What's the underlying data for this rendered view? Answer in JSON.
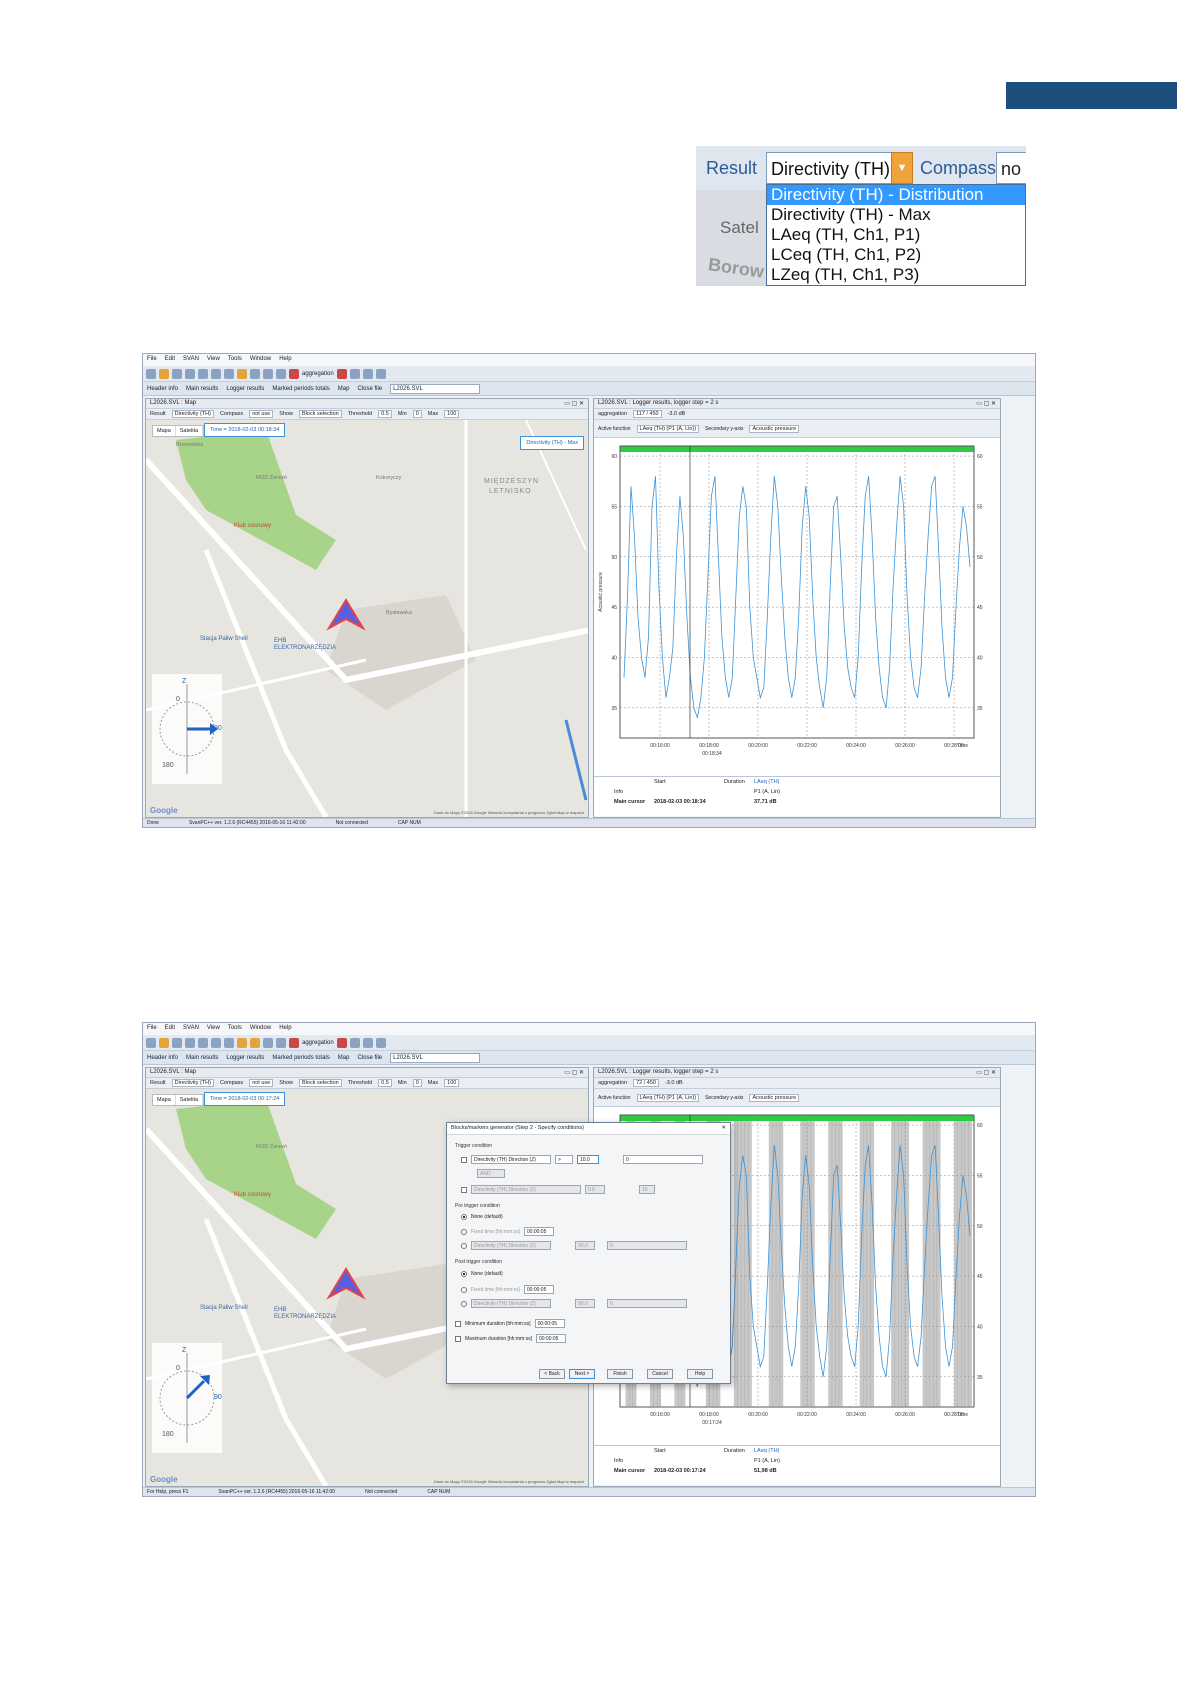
{
  "dropdown_zoom": {
    "result_label": "Result",
    "selected": "Directivity (TH)",
    "compass_label": "Compass",
    "compass_value": "no",
    "options": [
      "Directivity (TH) - Distribution",
      "Directivity (TH) - Max",
      "LAeq (TH, Ch1, P1)",
      "LCeq (TH, Ch1, P2)",
      "LZeq (TH, Ch1, P3)"
    ],
    "map_label_satellite": "Satel",
    "map_label_borow": "Borow"
  },
  "app": {
    "menu": [
      "File",
      "Edit",
      "SVAN",
      "View",
      "Tools",
      "Window",
      "Help"
    ],
    "toolbar_aggregation": "aggregation",
    "tabs": [
      "Header info",
      "Main results",
      "Logger results",
      "Marked periods totals",
      "Map"
    ],
    "close_file_label": "Close file",
    "file_name": "L2026.SVL",
    "status_left": "Done",
    "status_left_2": "For Help, press F1",
    "status_version": "SvanPC++ ver. 1.2.6 (RC4455) 2016-05-16 11:42:00",
    "status_conn": "Not connected",
    "status_caps": "CAP  NUM"
  },
  "map_window": {
    "title": "L2026.SVL : Map",
    "result_label": "Result",
    "result_value": "Directivity (TH)",
    "compass_label": "Compass",
    "compass_value": "not use",
    "show_label": "Show",
    "show_value": "Block selection",
    "threshold_label": "Threshold",
    "threshold_value": "0.5",
    "min_label": "Min",
    "min_value": "0",
    "max_label": "Max",
    "max_value": "100",
    "maptype": [
      "Mapa",
      "Satelita"
    ],
    "time_1": "Time = 2018-02-03 00:18:34",
    "time_2": "Time = 2018-02-03 00:17:24",
    "dir_label": "Directivity (TH) - Max",
    "labels": {
      "rod": "ROD Żerzeń",
      "las": "Klub sosnowy",
      "miedzeszyn": "MIĘDZESZYN",
      "letnisko": "LETNISKO",
      "statoil": "Stacja Paliw Shell",
      "ehb": "EHB",
      "ehb2": "ELEKTRONARZĘDZIA",
      "street1": "Bronowska",
      "street2": "Bysławska",
      "street3": "Kokoryczy",
      "street4": "Wał Miedzeszyński"
    },
    "compass_z": "Z",
    "compass_0": "0",
    "compass_90": "90",
    "compass_180": "180",
    "google": "Google",
    "attribution": "Dane do Mapy ©2018 Google   Warunki korzystania z programu   Zgłoś błąd w mapach"
  },
  "logger_window": {
    "title_1": "L2026.SVL : Logger results, logger step = 2 s",
    "title_2": "L2026.SVL : Logger results, logger step = 2 s",
    "aggregation": "aggregation",
    "page_1": "117 / 450",
    "page_2": "72 / 450",
    "db_step": "-3.0 dB",
    "active_label": "Active function",
    "active_value": "LAeq (TH) (P1 (A, Lin))",
    "secondary_label": "Secondary y-axis",
    "secondary_value": "Acoustic pressure",
    "ylabel": "Acoustic pressure",
    "time_label": "Time",
    "cursor_1": "00:18:34",
    "cursor_2": "00:17:24",
    "bottom": {
      "start": "Start",
      "duration": "Duration",
      "series": "LAeq (TH)",
      "info": "Info",
      "p1": "P1 (A, Lin)",
      "main_cursor": "Main cursor",
      "cursor_date_1": "2018-02-03 00:18:34",
      "cursor_val_1": "37,71 dB",
      "cursor_date_2": "2018-02-03 00:17:24",
      "cursor_val_2": "51,98 dB",
      "dash": "-"
    },
    "side_tab": "Configuration"
  },
  "chart_data": {
    "type": "line",
    "x": [
      "00:16:00",
      "00:18:00",
      "00:20:00",
      "00:22:00",
      "00:24:00",
      "00:26:00",
      "00:28:00"
    ],
    "ylim": [
      32,
      61
    ],
    "yticks": [
      35,
      40,
      45,
      50,
      55,
      60
    ],
    "ylabel": "Acoustic pressure",
    "xlabel": "Time",
    "series": [
      {
        "values": [
          38,
          46,
          57,
          52,
          44,
          40,
          38,
          42,
          55,
          58,
          47,
          40,
          36,
          38,
          41,
          50,
          56,
          52,
          44,
          38,
          35,
          34,
          36,
          40,
          48,
          56,
          58,
          50,
          42,
          38,
          36,
          38,
          46,
          54,
          57,
          55,
          45,
          40,
          38,
          36,
          37,
          44,
          52,
          58,
          55,
          48,
          42,
          38,
          36,
          38,
          44,
          53,
          57,
          54,
          46,
          40,
          37,
          35,
          38,
          47,
          55,
          56,
          50,
          43,
          39,
          37,
          36,
          40,
          49,
          56,
          58,
          52,
          44,
          39,
          36,
          35,
          39,
          47,
          53,
          58,
          55,
          46,
          40,
          37,
          36,
          39,
          46,
          52,
          57,
          58,
          51,
          43,
          38,
          36,
          38,
          45,
          51,
          55,
          53,
          49
        ]
      }
    ]
  },
  "dialog": {
    "title": "Blocks/markers generator (Step 2 - Specify conditions)",
    "trigger": "Trigger condition",
    "func1": "Directivity (TH) Direction (Z)",
    "op1": ">",
    "val1": "10.0",
    "and": "AND",
    "func2": "Directivity (TH) Direction (Z)",
    "val2": "0.0",
    "val3": "10",
    "pre": "Pre trigger condition",
    "none_default": "None (default)",
    "fixed_time": "Fixed time [hh:mm:ss]",
    "fixed_val": "00:00:05",
    "func3": "Directivity (TH) Direction (Z)",
    "val4": "90.0",
    "val5": "0",
    "post": "Post trigger condition",
    "min_dur": "Minimum duration [hh:mm:ss]",
    "min_val": "00:00:05",
    "max_dur": "Maximum duration [hh:mm:ss]",
    "max_val": "00:00:05",
    "buttons": [
      "< Back",
      "Next >",
      "Finish",
      "Cancel",
      "Help"
    ]
  }
}
